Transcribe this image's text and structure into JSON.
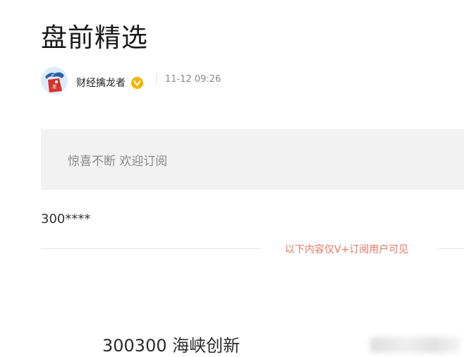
{
  "article": {
    "title": "盘前精选",
    "author": {
      "name": "财经擒龙者",
      "avatar_icon": "dragon-mascot-avatar",
      "verified_icon": "verified-badge-icon",
      "verified_color": "#f5b400"
    },
    "timestamp": "11-12 09:26",
    "promo_text": "惊喜不断 欢迎订阅",
    "stock_code": "300****",
    "vip_notice": "以下内容仅V+订阅用户可见",
    "stock_name": "300300 海峡创新"
  },
  "colors": {
    "title": "#1a1a1a",
    "promo_bg": "#f2f2f2",
    "vip_notice": "#e8745e",
    "muted_text": "#8a8a8a"
  }
}
